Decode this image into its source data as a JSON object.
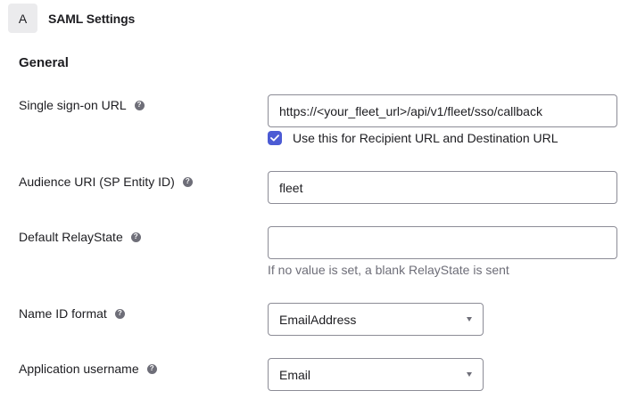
{
  "header": {
    "step_letter": "A",
    "title": "SAML Settings"
  },
  "section": {
    "title": "General"
  },
  "fields": {
    "sso_url": {
      "label": "Single sign-on URL",
      "value": "https://<your_fleet_url>/api/v1/fleet/sso/callback",
      "checkbox_label": "Use this for Recipient URL and Destination URL",
      "checkbox_checked": true
    },
    "audience_uri": {
      "label": "Audience URI (SP Entity ID)",
      "value": "fleet"
    },
    "relay_state": {
      "label": "Default RelayState",
      "value": "",
      "hint": "If no value is set, a blank RelayState is sent"
    },
    "name_id_format": {
      "label": "Name ID format",
      "selected": "EmailAddress"
    },
    "app_username": {
      "label": "Application username",
      "selected": "Email"
    }
  },
  "icons": {
    "help": "question-mark",
    "check": "check-mark",
    "dropdown": "caret-down"
  },
  "colors": {
    "accent": "#4c5bd4",
    "text": "#1d1d21",
    "muted": "#6e6e78",
    "border": "#8c8c96"
  }
}
